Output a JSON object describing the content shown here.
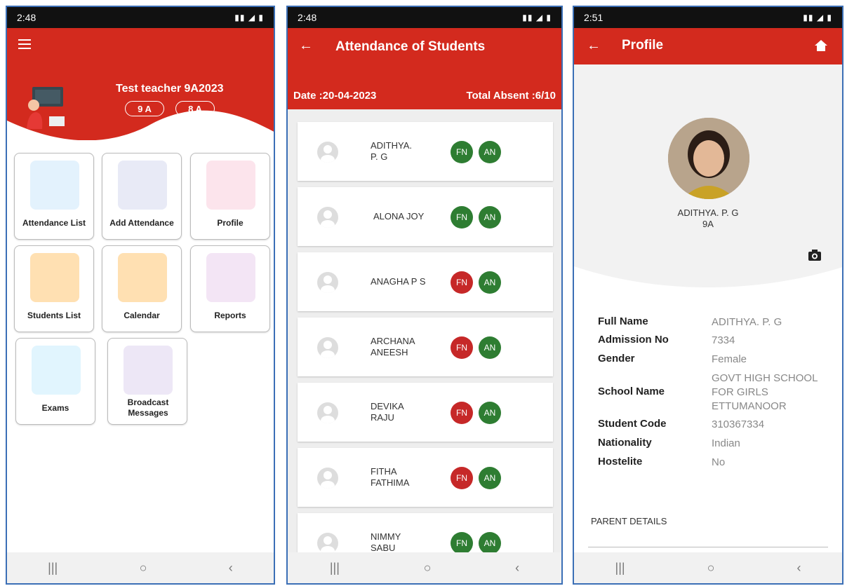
{
  "colors": {
    "primary": "#d32a1e",
    "green": "#2e7d32",
    "red": "#c62828"
  },
  "screen1": {
    "time": "2:48",
    "menu_icon": "hamburger-icon",
    "teacher_name": "Test teacher 9A2023",
    "classes": [
      "9 A",
      "8 A"
    ],
    "tiles": [
      {
        "label": "Attendance List",
        "icon": "attendance-list-illustration"
      },
      {
        "label": "Add Attendance",
        "icon": "add-attendance-illustration"
      },
      {
        "label": "Profile",
        "icon": "profile-illustration"
      },
      {
        "label": "Students List",
        "icon": "students-list-illustration"
      },
      {
        "label": "Calendar",
        "icon": "calendar-illustration"
      },
      {
        "label": "Reports",
        "icon": "reports-illustration"
      },
      {
        "label": "Exams",
        "icon": "exams-illustration"
      },
      {
        "label": "Broadcast Messages",
        "icon": "broadcast-illustration"
      }
    ]
  },
  "screen2": {
    "time": "2:48",
    "title": "Attendance of Students",
    "date": "Date :20-04-2023",
    "total_absent": "Total Absent :6/10",
    "students": [
      {
        "name": "ADITHYA. P. G",
        "fn": "FN",
        "an": "AN",
        "fn_absent": false,
        "an_absent": false
      },
      {
        "name": "ALONA JOY",
        "fn": "FN",
        "an": "AN",
        "fn_absent": false,
        "an_absent": false
      },
      {
        "name": "ANAGHA P S",
        "fn": "FN",
        "an": "AN",
        "fn_absent": true,
        "an_absent": false
      },
      {
        "name": "ARCHANA ANEESH",
        "fn": "FN",
        "an": "AN",
        "fn_absent": true,
        "an_absent": false
      },
      {
        "name": "DEVIKA RAJU",
        "fn": "FN",
        "an": "AN",
        "fn_absent": true,
        "an_absent": false
      },
      {
        "name": "FITHA FATHIMA",
        "fn": "FN",
        "an": "AN",
        "fn_absent": true,
        "an_absent": false
      },
      {
        "name": "NIMMY SABU",
        "fn": "FN",
        "an": "AN",
        "fn_absent": false,
        "an_absent": false
      }
    ]
  },
  "screen3": {
    "time": "2:51",
    "title": "Profile",
    "student_name": "ADITHYA. P. G",
    "student_class": "9A",
    "fields": [
      {
        "label": "Full Name",
        "value": "ADITHYA. P. G"
      },
      {
        "label": "Admission No",
        "value": "7334"
      },
      {
        "label": "Gender",
        "value": "Female"
      },
      {
        "label": "School Name",
        "value": "GOVT HIGH SCHOOL FOR GIRLS ETTUMANOOR"
      },
      {
        "label": "Student Code",
        "value": "310367334"
      },
      {
        "label": "Nationality",
        "value": "Indian"
      },
      {
        "label": "Hostelite",
        "value": "No"
      }
    ],
    "parent_details": "PARENT DETAILS"
  }
}
